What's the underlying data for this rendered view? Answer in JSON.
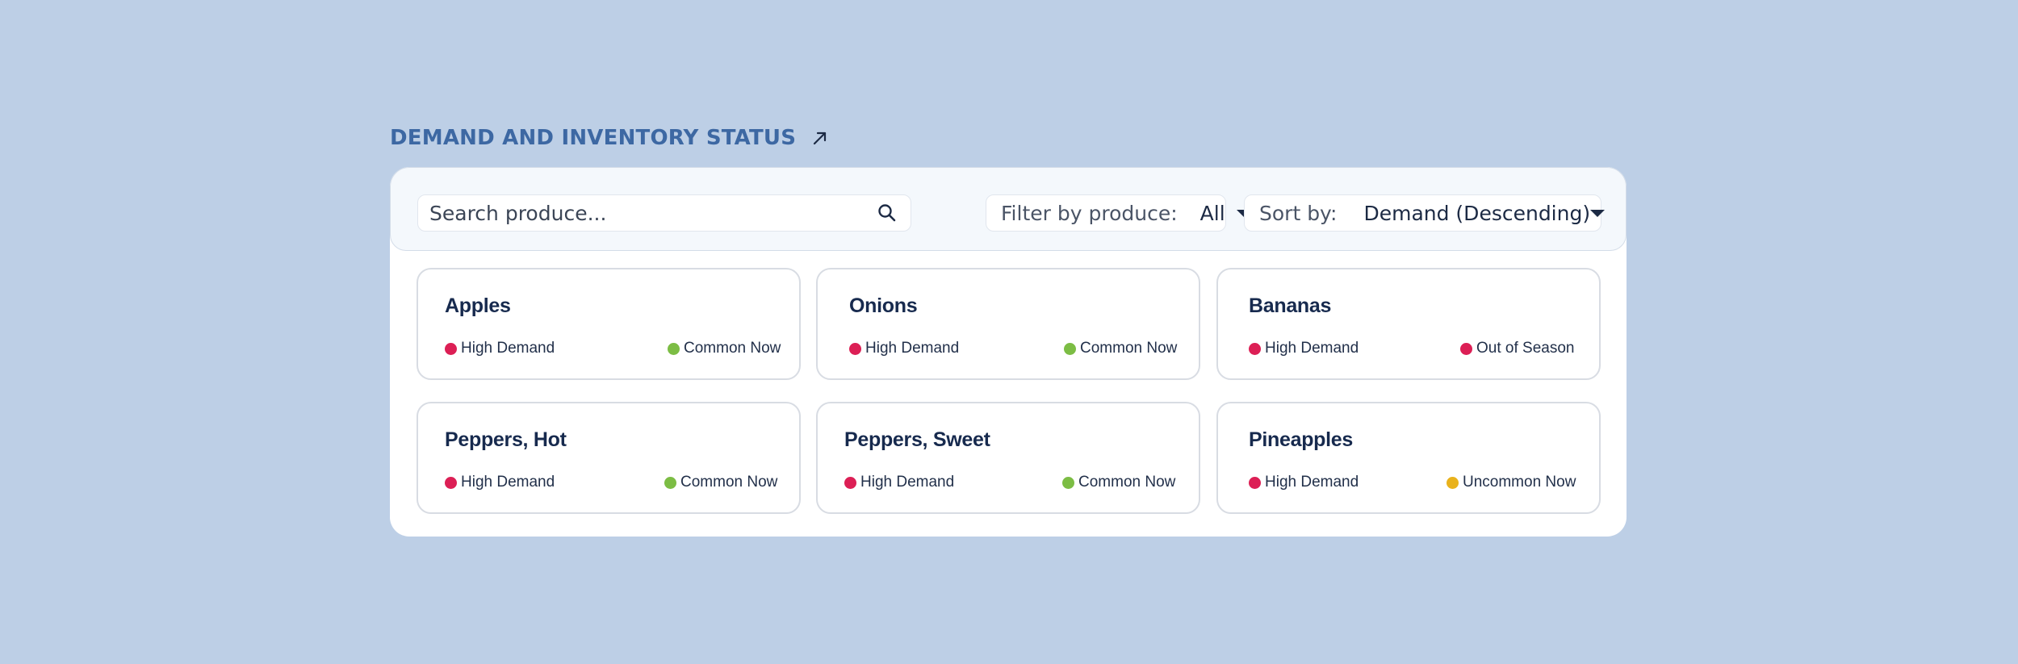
{
  "header": {
    "title": "DEMAND AND INVENTORY STATUS",
    "link_icon": "arrow-up-right-icon"
  },
  "search": {
    "placeholder": "Search produce...",
    "icon": "search-icon"
  },
  "filter": {
    "label": "Filter by produce:",
    "value": "All",
    "icon": "caret-down-icon"
  },
  "sort": {
    "label": "Sort by:",
    "value": "Demand (Descending)",
    "icon": "caret-down-icon"
  },
  "colors": {
    "background": "#bdcfe6",
    "header": "#3d68a3",
    "high_demand": "#dc1f55",
    "common_now": "#7cbd44",
    "out_of_season": "#dc1f55",
    "uncommon_now": "#e9b21c"
  },
  "cards": [
    {
      "name": "Apples",
      "demand": "High Demand",
      "demand_color": "#dc1f55",
      "availability": "Common Now",
      "availability_color": "#7cbd44"
    },
    {
      "name": "Onions",
      "demand": "High Demand",
      "demand_color": "#dc1f55",
      "availability": "Common Now",
      "availability_color": "#7cbd44"
    },
    {
      "name": "Bananas",
      "demand": "High Demand",
      "demand_color": "#dc1f55",
      "availability": "Out of Season",
      "availability_color": "#dc1f55"
    },
    {
      "name": "Peppers, Hot",
      "demand": "High Demand",
      "demand_color": "#dc1f55",
      "availability": "Common Now",
      "availability_color": "#7cbd44"
    },
    {
      "name": "Peppers, Sweet",
      "demand": "High Demand",
      "demand_color": "#dc1f55",
      "availability": "Common Now",
      "availability_color": "#7cbd44"
    },
    {
      "name": "Pineapples",
      "demand": "High Demand",
      "demand_color": "#dc1f55",
      "availability": "Uncommon Now",
      "availability_color": "#e9b21c"
    }
  ]
}
